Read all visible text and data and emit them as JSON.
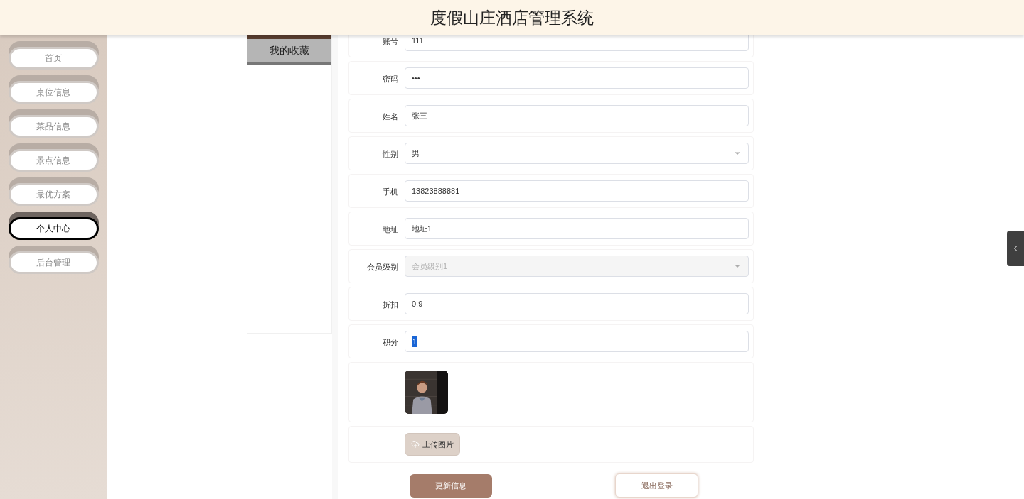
{
  "header": {
    "title": "度假山庄酒店管理系统"
  },
  "sidebar": {
    "items": [
      {
        "label": "首页",
        "selected": false
      },
      {
        "label": "桌位信息",
        "selected": false
      },
      {
        "label": "菜品信息",
        "selected": false
      },
      {
        "label": "景点信息",
        "selected": false
      },
      {
        "label": "最优方案",
        "selected": false
      },
      {
        "label": "个人中心",
        "selected": true
      },
      {
        "label": "后台管理",
        "selected": false
      }
    ]
  },
  "side_menu": {
    "items": [
      {
        "label": "我的收藏"
      }
    ]
  },
  "form": {
    "fields": [
      {
        "kind": "text",
        "label": "账号",
        "value": "111"
      },
      {
        "kind": "password",
        "label": "密码",
        "value": "•••"
      },
      {
        "kind": "text",
        "label": "姓名",
        "value": "张三"
      },
      {
        "kind": "select",
        "label": "性别",
        "value": "男",
        "disabled": false
      },
      {
        "kind": "text",
        "label": "手机",
        "value": "13823888881"
      },
      {
        "kind": "text",
        "label": "地址",
        "value": "地址1"
      },
      {
        "kind": "select",
        "label": "会员级别",
        "value": "会员级别1",
        "disabled": true
      },
      {
        "kind": "text",
        "label": "折扣",
        "value": "0.9"
      },
      {
        "kind": "selected-text",
        "label": "积分",
        "value": "1"
      },
      {
        "kind": "picture"
      },
      {
        "kind": "upload",
        "label": "上传图片"
      }
    ],
    "buttons": [
      {
        "kind": "primary",
        "label": "更新信息"
      },
      {
        "kind": "outline",
        "label": "退出登录"
      }
    ]
  }
}
